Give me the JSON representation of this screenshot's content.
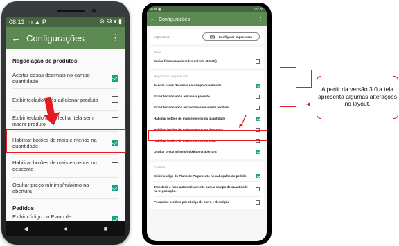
{
  "phone1": {
    "status": {
      "time": "08:13",
      "icons": "m ▲ P",
      "right_icons": "⊘ ☊ ▾ ▮"
    },
    "toolbar": {
      "back": "←",
      "title": "Configurações",
      "menu": "⋮"
    },
    "section_negociacao": "Negociação de produtos",
    "rows": [
      {
        "label": "Aceitar casas decimais no campo quantidade",
        "checked": true
      },
      {
        "label": "Exibir teclado após adicionar produto",
        "checked": false
      },
      {
        "label": "Exibir teclado após fechar tela sem inserir produto",
        "checked": false
      },
      {
        "label": "Habilitar botões de mais e menos na quantidade",
        "checked": true
      },
      {
        "label": "Habilitar botões de mais e menos no desconto",
        "checked": false
      },
      {
        "label": "Ocultar preço mínimo/máximo na abertura",
        "checked": true
      }
    ],
    "section_pedidos": "Pedidos",
    "row_pedidos": "Exibir código do Plano de Pagamento no",
    "nav": {
      "back": "◀",
      "home": "●",
      "recent": "■"
    }
  },
  "phone2": {
    "status": {
      "left": "⊕ ✉ ▣",
      "right": "09:28"
    },
    "toolbar": {
      "back": "←",
      "title": "Configurações",
      "menu": "⋮"
    },
    "printer": {
      "label": "Impressora",
      "button": "Configurar impressora"
    },
    "section_rede": "Rede",
    "rede_rows": [
      {
        "label": "Enviar fotos usando redes móveis (3G/4G)",
        "checked": false
      }
    ],
    "section_negociacao": "Negociação de produtos",
    "neg_rows": [
      {
        "label": "Aceitar casas decimais no campo quantidade",
        "checked": true
      },
      {
        "label": "Exibir teclado após adicionar produto",
        "checked": false
      },
      {
        "label": "Exibir teclado após fechar tela sem inserir produto",
        "checked": false
      },
      {
        "label": "Habilitar botões de mais e menos na quantidade",
        "checked": true
      },
      {
        "label": "Habilitar botões de mais e menos no desconto",
        "checked": false
      },
      {
        "label": "Habilitar botões de mais e menos no valor",
        "checked": false
      },
      {
        "label": "Ocultar preço mínimo/máximo na abertura",
        "checked": true
      }
    ],
    "section_pedidos": "Pedidos",
    "ped_rows": [
      {
        "label": "Exibir código do Plano de Pagamento no cabeçalho do pedido",
        "checked": true
      },
      {
        "label": "Transferir o foco automaticamente para o campo de quantidade na negociação.",
        "checked": false
      },
      {
        "label": "Pesquisar produto por código de barra e descrição",
        "checked": false
      }
    ]
  },
  "note": "A partir da versão 3.0 a tela apresenta algumas alterações no layout.",
  "colors": {
    "toolbar": "#5d8a52",
    "status": "#46663f",
    "checkbox": "#1aa384",
    "highlight": "#e31b23"
  }
}
